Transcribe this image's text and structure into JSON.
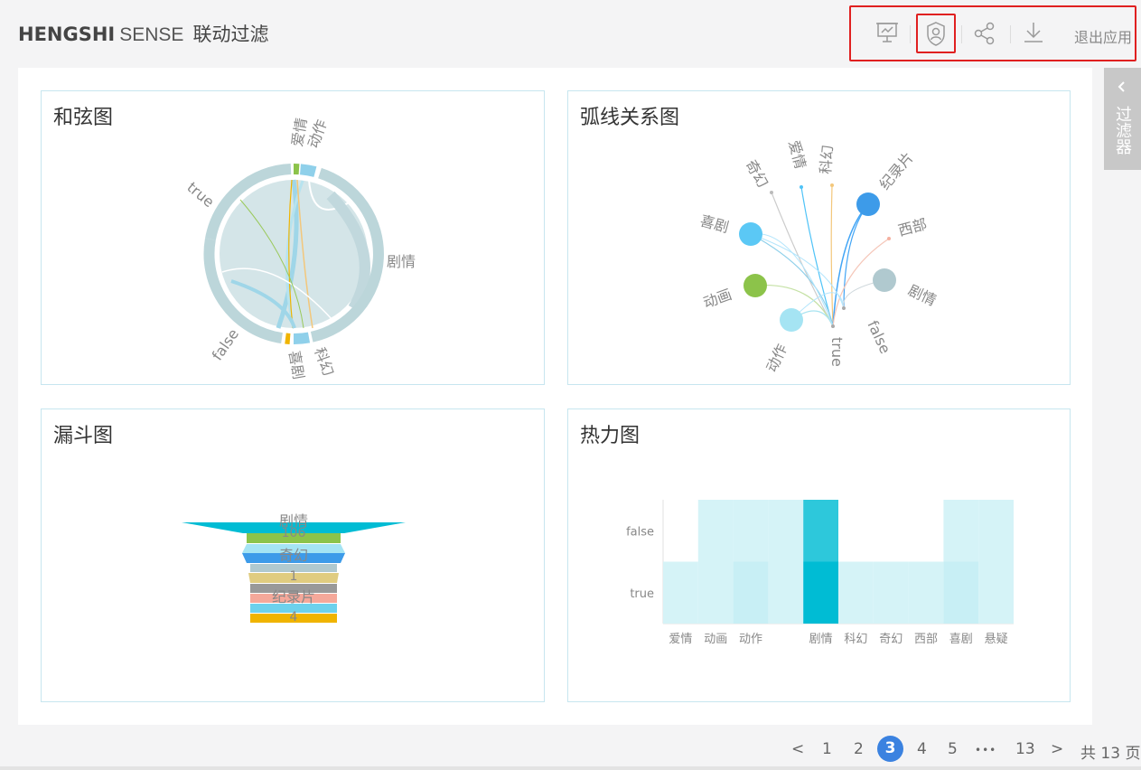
{
  "app": {
    "brand_bold": "HENGSHI",
    "brand_light": "SENSE",
    "page_title": "联动过滤"
  },
  "toolbar": {
    "icons": [
      "presentation-icon",
      "user-shield-icon",
      "share-icon",
      "download-icon"
    ],
    "exit_label": "退出应用"
  },
  "side_panel": {
    "label": "过滤器"
  },
  "cards": {
    "chord": {
      "title": "和弦图",
      "labels": [
        "爱情",
        "动作",
        "true",
        "剧情",
        "false",
        "喜剧",
        "科幻"
      ]
    },
    "arc": {
      "title": "弧线关系图",
      "labels": [
        "奇幻",
        "爱情",
        "科幻",
        "纪录片",
        "喜剧",
        "西部",
        "动画",
        "剧情",
        "动作",
        "true",
        "false"
      ]
    },
    "funnel": {
      "title": "漏斗图",
      "labels": [
        "剧情",
        "106",
        "奇幻",
        "1",
        "纪录片",
        "4"
      ]
    },
    "heatmap": {
      "title": "热力图"
    }
  },
  "chart_data": [
    {
      "type": "heatmap",
      "y_categories": [
        "false",
        "true"
      ],
      "x_categories": [
        "爱情",
        "动画",
        "动作",
        "",
        "剧情",
        "科幻",
        "奇幻",
        "西部",
        "喜剧",
        "悬疑"
      ],
      "values": [
        [
          0,
          1,
          1,
          1,
          8,
          0,
          0,
          0,
          1,
          1
        ],
        [
          1,
          1,
          2,
          1,
          10,
          1,
          1,
          1,
          2,
          1
        ]
      ],
      "colors": {
        "low": "#e3f6f9",
        "high": "#00bcd4"
      }
    }
  ],
  "pagination": {
    "prev": "<",
    "next": ">",
    "pages": [
      "1",
      "2",
      "3",
      "4",
      "5",
      "•••",
      "13"
    ],
    "current": "3",
    "total_label": "共 13 页"
  }
}
